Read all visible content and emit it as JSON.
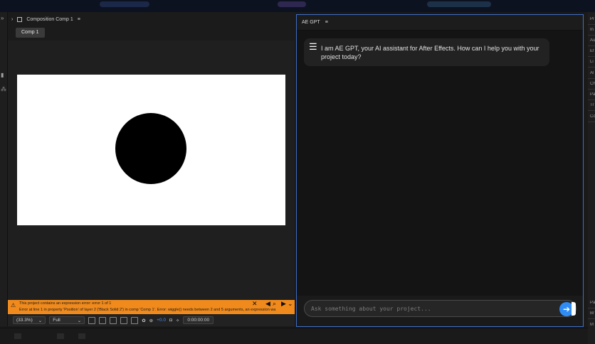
{
  "composition_panel": {
    "header_title": "Composition Comp 1",
    "tab_label": "Comp 1",
    "error": {
      "summary": "This project contains an expression error: error 1 of 1",
      "detail": "Error at line 1 in property 'Position' of layer 2 ('Black Solid 2') in comp 'Comp 1'. Error: wiggle() needs between 2 and 5 arguments, an expression wa"
    },
    "footer": {
      "zoom": "(33.3%)",
      "resolution": "Full",
      "exposure": "+0.0",
      "timecode": "0:00:00:00"
    },
    "canvas_background": "#ffffff",
    "shape_color": "#000000"
  },
  "ae_gpt": {
    "title": "AE GPT",
    "message": "I am AE GPT, your AI assistant for After Effects. How can I help you with your project today?",
    "input_placeholder": "Ask something about your project...",
    "accent_color": "#2f8cf5"
  },
  "right_rail": {
    "labels": [
      "Pr",
      "In",
      "Au",
      "Ef",
      "Li",
      "Al",
      "Ch",
      "Pa",
      "Tr",
      "Co"
    ],
    "bottom_labels": [
      "Pa",
      "Br",
      "M"
    ]
  },
  "icons": {
    "send": "arrow-right-icon",
    "menu": "hamburger-menu-icon",
    "warning": "warning-icon"
  }
}
